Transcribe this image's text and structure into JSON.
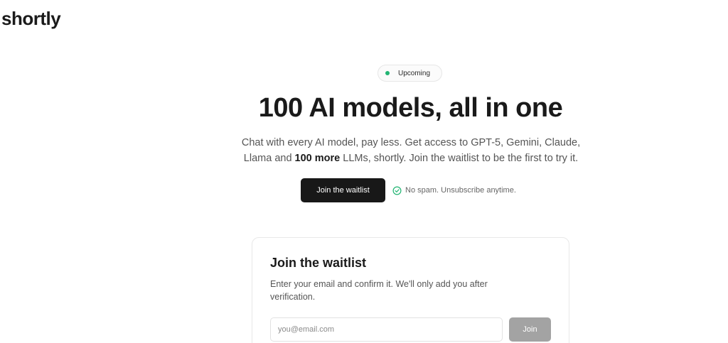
{
  "header": {
    "logo_text": "shortly"
  },
  "hero": {
    "badge_label": "Upcoming",
    "title": "100 AI models, all in one",
    "subtitle_line1": "Chat with every AI model, pay less. Get access to GPT-5, Gemini, Claude,",
    "subtitle_line2_before": "Llama and ",
    "subtitle_line2_bold": "100 more",
    "subtitle_line2_after": " LLMs, shortly. Join the waitlist to be the first to try it.",
    "cta_label": "Join the waitlist",
    "no_spam_text": "No spam. Unsubscribe anytime."
  },
  "waitlist_card": {
    "title": "Join the waitlist",
    "description": "Enter your email and confirm it. We'll only add you after verification.",
    "email_placeholder": "you@email.com",
    "email_value": "",
    "join_label": "Join"
  },
  "colors": {
    "status_dot": "#22b573",
    "cta_background": "#181818",
    "join_button_disabled": "#a3a3a3",
    "check_icon": "#22b573"
  },
  "icons": {
    "status_dot": "status-dot-icon",
    "no_spam_check": "check-circle-icon"
  }
}
